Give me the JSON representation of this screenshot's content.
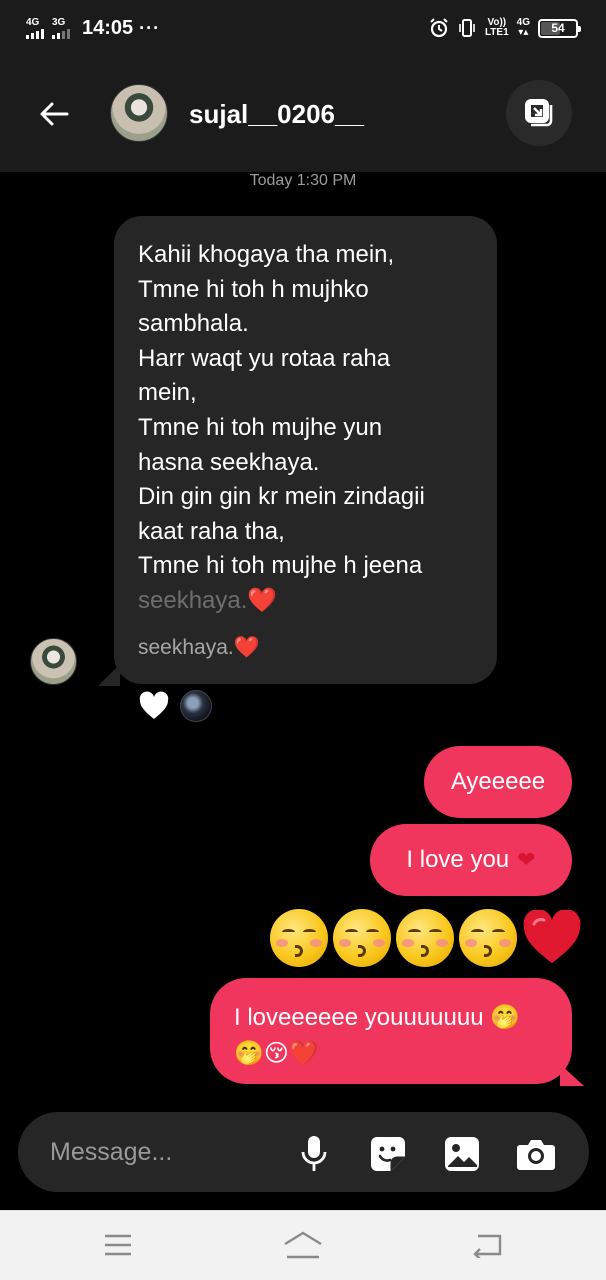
{
  "status_bar": {
    "network_1": "4G",
    "network_2": "3G",
    "time": "14:05",
    "more_indicator": "···",
    "volte_top": "Vo))",
    "volte_bottom": "LTE1",
    "network_3": "4G",
    "battery_level": "54",
    "icons": [
      "signal-icon",
      "alarm-icon",
      "vibrate-icon",
      "battery-icon"
    ]
  },
  "header": {
    "username": "sujal__0206__",
    "icons": [
      "back-arrow-icon",
      "video-chat-icon"
    ]
  },
  "chat": {
    "timestamp": "Today 1:30 PM",
    "incoming_lines": [
      "Kahii khogaya tha mein,",
      "Tmne hi toh h mujhko",
      "sambhala.",
      "Harr waqt yu rotaa raha",
      "mein,",
      "Tmne hi toh mujhe yun",
      "hasna seekhaya.",
      "Din gin gin kr mein zindagii",
      "kaat raha tha,",
      "Tmne hi toh mujhe h jeena",
      "seekhaya.❤️"
    ],
    "incoming_reply": "seekhaya.❤️",
    "reaction": "heart-reaction-icon",
    "outgoing": {
      "msg1": "Ayeeeee",
      "msg2": "I love you",
      "msg2_emoji": "❤",
      "emoji_row": [
        "😚",
        "😚",
        "😚",
        "😚",
        "❤️"
      ],
      "msg3_line1": "I loveeeeee youuuuuuu 🤭",
      "msg3_line2": "🤭😚❤️"
    }
  },
  "composer": {
    "placeholder": "Message...",
    "icons": [
      "microphone-icon",
      "sticker-icon",
      "gallery-icon",
      "camera-icon"
    ]
  },
  "nav": {
    "icons": [
      "menu-icon",
      "home-icon",
      "back-icon"
    ]
  },
  "colors": {
    "outgoing_bubble": "#f0365d",
    "incoming_bubble": "#262626",
    "background": "#000000",
    "bar": "#1b1b1b"
  }
}
